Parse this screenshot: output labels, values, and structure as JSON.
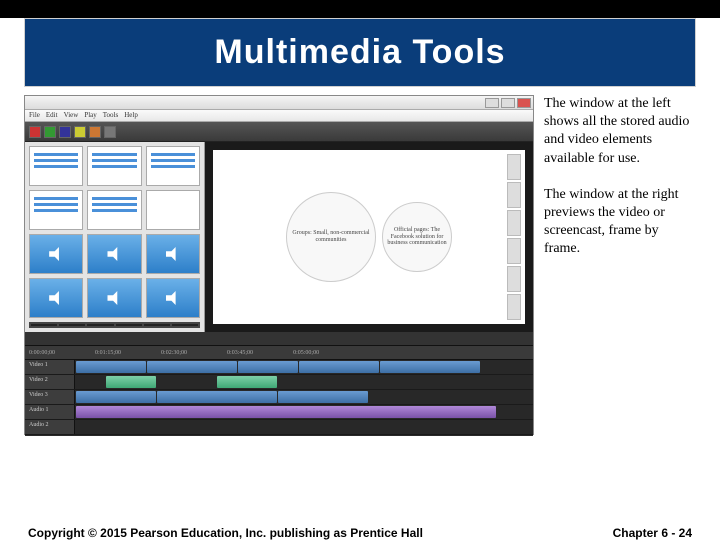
{
  "title": "Multimedia Tools",
  "captions": {
    "left_window": "The window at the left shows all the stored audio and video elements available for use.",
    "right_window": "The window at the right previews the video or screencast, frame by frame."
  },
  "editor": {
    "menu": [
      "File",
      "Edit",
      "View",
      "Play",
      "Tools",
      "Help"
    ],
    "preview_bubbles": {
      "big": "Groups: Small, non-commercial communities",
      "small": "Official pages: The Facebook solution for business communication"
    },
    "timeline_tracks": [
      "Video 1",
      "Video 2",
      "Video 3",
      "Audio 1",
      "Audio 2"
    ],
    "time_marks": [
      "0:00:00;00",
      "0:01:15;00",
      "0:02:30;00",
      "0:03:45;00",
      "0:05:00;00"
    ]
  },
  "footer": {
    "copyright": "Copyright © 2015 Pearson Education, Inc. publishing as Prentice Hall",
    "pager": "Chapter 6 - 24"
  }
}
